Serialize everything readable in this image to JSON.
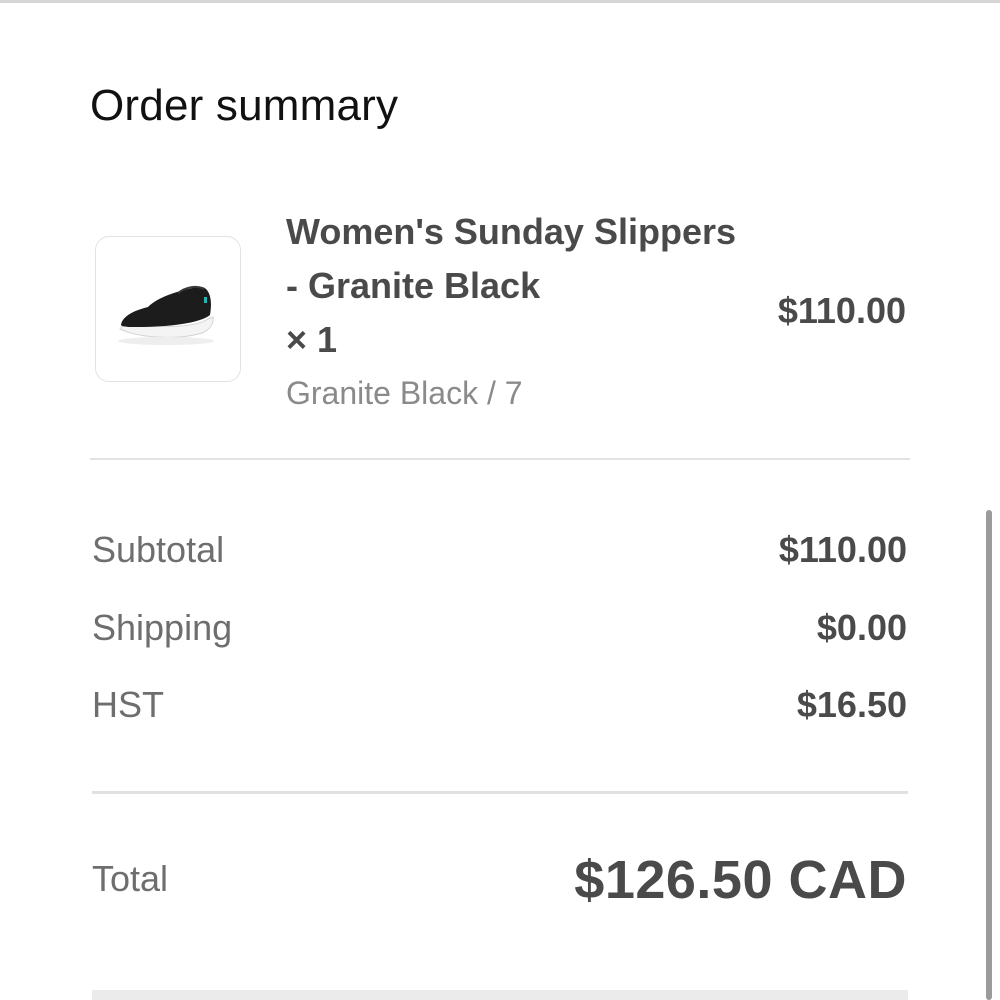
{
  "order_summary": {
    "title": "Order summary",
    "item": {
      "name": "Women's Sunday Slippers - Granite Black",
      "quantity": "× 1",
      "variant": "Granite Black / 7",
      "price": "$110.00",
      "image_icon": "slipper-shoe-image"
    },
    "costs": {
      "subtotal_label": "Subtotal",
      "subtotal_value": "$110.00",
      "shipping_label": "Shipping",
      "shipping_value": "$0.00",
      "tax_label": "HST",
      "tax_value": "$16.50"
    },
    "total": {
      "label": "Total",
      "value": "$126.50 CAD"
    }
  },
  "colors": {
    "primary_text": "#111111",
    "value_text": "#4a4a4a",
    "muted_text": "#8a8a8a",
    "divider": "#e3e3e3"
  }
}
